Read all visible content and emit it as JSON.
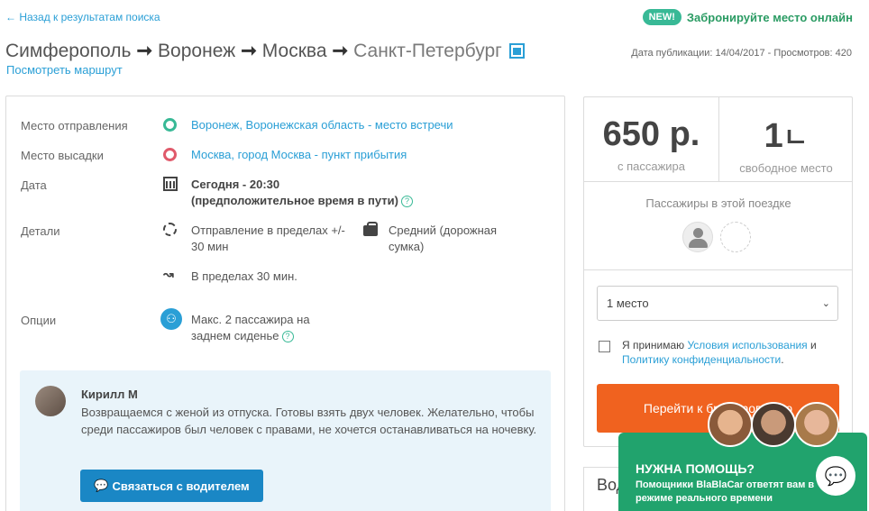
{
  "header": {
    "back_link": "← Назад к результатам поиска",
    "new_badge": "NEW!",
    "online_booking": "Забронируйте место онлайн",
    "route": {
      "cities": [
        "Симферополь",
        "Воронеж",
        "Москва",
        "Санкт-Петербург"
      ],
      "arrow": "➞"
    },
    "view_route": "Посмотреть маршрут",
    "publication": "Дата публикации: 14/04/2017 - Просмотров: 420"
  },
  "details": {
    "departure_label": "Место отправления",
    "departure_value": "Воронеж, Воронежская область - место встречи",
    "dropoff_label": "Место высадки",
    "dropoff_value": "Москва, город Москва - пункт прибытия",
    "date_label": "Дата",
    "date_value": "Сегодня - 20:30",
    "date_note": "(предположительное время в пути)",
    "details_label": "Детали",
    "departure_window": "Отправление в пределах +/- 30 мин",
    "luggage": "Средний (дорожная сумка)",
    "detour": "В пределах 30 мин.",
    "options_label": "Опции",
    "options_value": "Макс. 2 пассажира на заднем сиденье",
    "help_glyph": "?"
  },
  "driver": {
    "name": "Кирилл М",
    "message": "Возвращаемся с женой из отпуска. Готовы взять двух человек. Желательно, чтобы среди пассажиров был человек с правами, не хочется останавливаться на ночевку.",
    "contact_button": "Связаться с водителем"
  },
  "booking": {
    "price": "650 р.",
    "price_label": "с пассажира",
    "seats_left": "1",
    "seats_label": "свободное место",
    "passengers_title": "Пассажиры в этой поездке",
    "seat_select": "1 место",
    "terms_prefix": "Я принимаю ",
    "terms_link": "Условия использования",
    "terms_and": " и",
    "privacy_link": "Политику конфиденциальности",
    "terms_suffix": ".",
    "book_button": "Перейти к бронированию"
  },
  "vod_label": "Вод",
  "help": {
    "title": "НУЖНА ПОМОЩЬ?",
    "subtitle": "Помощники BlaBlaCar ответят вам в режиме реального времени"
  },
  "colors": {
    "link": "#2a9fd6",
    "green": "#21a36d",
    "orange": "#f0621f",
    "contact_button": "#1a87c5"
  }
}
